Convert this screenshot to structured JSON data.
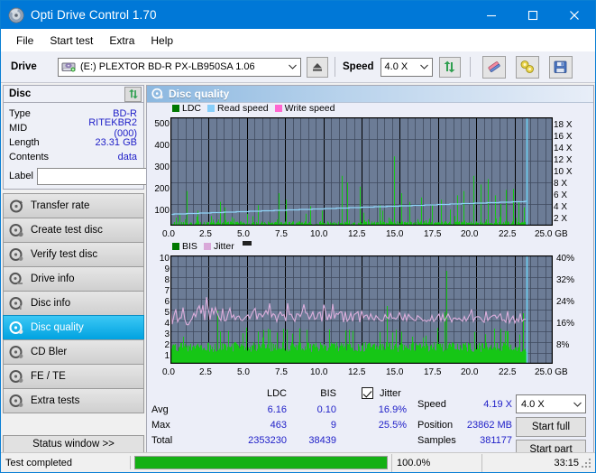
{
  "window": {
    "title": "Opti Drive Control 1.70",
    "icon": "disc-icon",
    "minimize": "−",
    "maximize": "□",
    "close": "✕",
    "titlebar_color": "#0078d7"
  },
  "menu": {
    "items": [
      "File",
      "Start test",
      "Extra",
      "Help"
    ]
  },
  "toolbar": {
    "drive_label": "Drive",
    "drive_value": "(E:)   PLEXTOR BD-R  PX-LB950SA 1.06",
    "eject_icon": "eject-icon",
    "speed_label": "Speed",
    "speed_value": "4.0 X",
    "refresh_icon": "refresh-icon",
    "erase_icon": "eraser-icon",
    "settings_icon": "wrench-icon",
    "save_icon": "floppy-save-icon"
  },
  "disc": {
    "header": "Disc",
    "refresh_icon": "refresh-icon",
    "rows": [
      {
        "key": "Type",
        "value": "BD-R"
      },
      {
        "key": "MID",
        "value": "RITEKBR2 (000)"
      },
      {
        "key": "Length",
        "value": "23.31 GB"
      },
      {
        "key": "Contents",
        "value": "data"
      }
    ],
    "label_key": "Label",
    "label_value": "",
    "label_placeholder": "",
    "label_button_icon": "disc-icon"
  },
  "nav": {
    "items": [
      {
        "label": "Transfer rate",
        "icon": "disc-transfer-icon",
        "selected": false
      },
      {
        "label": "Create test disc",
        "icon": "disc-create-icon",
        "selected": false
      },
      {
        "label": "Verify test disc",
        "icon": "disc-verify-icon",
        "selected": false
      },
      {
        "label": "Drive info",
        "icon": "disc-drive-icon",
        "selected": false
      },
      {
        "label": "Disc info",
        "icon": "disc-info-icon",
        "selected": false
      },
      {
        "label": "Disc quality",
        "icon": "disc-quality-icon",
        "selected": true
      },
      {
        "label": "CD Bler",
        "icon": "disc-bler-icon",
        "selected": false
      },
      {
        "label": "FE / TE",
        "icon": "disc-fete-icon",
        "selected": false
      },
      {
        "label": "Extra tests",
        "icon": "disc-extra-icon",
        "selected": false
      }
    ],
    "status_window": "Status window >>"
  },
  "main": {
    "header": "Disc quality",
    "header_icon": "disc-quality-icon"
  },
  "chart_data": [
    {
      "type": "line",
      "name": "top-chart",
      "title": "",
      "xlabel": "GB",
      "ylabel": "",
      "legend": [
        {
          "label": "LDC",
          "color": "#00a000"
        },
        {
          "label": "Read speed",
          "color": "#87cefa"
        },
        {
          "label": "Write speed",
          "color": "#ff66d0"
        }
      ],
      "legend_position": "top-left",
      "grid": true,
      "plot_bg": "#6c7c96",
      "x": [
        0.0,
        2.5,
        5.0,
        7.5,
        10.0,
        12.5,
        15.0,
        17.5,
        20.0,
        22.5,
        25.0
      ],
      "xtick_labels": [
        "0.0",
        "2.5",
        "5.0",
        "7.5",
        "10.0",
        "12.5",
        "15.0",
        "17.5",
        "20.0",
        "22.5",
        "25.0 GB"
      ],
      "xlim": [
        0,
        25
      ],
      "ylim": [
        0,
        500
      ],
      "ytick_labels": [
        "100",
        "200",
        "300",
        "400",
        "500"
      ],
      "yticks": [
        100,
        200,
        300,
        400,
        500
      ],
      "y2lim": [
        0,
        19
      ],
      "y2tick_labels": [
        "2 X",
        "4 X",
        "6 X",
        "8 X",
        "10 X",
        "12 X",
        "14 X",
        "16 X",
        "18 X"
      ],
      "y2ticks": [
        2,
        4,
        6,
        8,
        10,
        12,
        14,
        16,
        18
      ],
      "data_end_gb": 23.31,
      "series": [
        {
          "name": "LDC",
          "color": "#00c000",
          "style": "bars",
          "note": "mostly under 50, dense spikes; max 463 near 17.0 GB"
        },
        {
          "name": "Read speed",
          "color": "#87cefa",
          "style": "step-line",
          "note": "rises 2.0X to 4.2X across disc"
        }
      ]
    },
    {
      "type": "line",
      "name": "bottom-chart",
      "title": "",
      "xlabel": "GB",
      "ylabel": "",
      "legend": [
        {
          "label": "BIS",
          "color": "#00a000"
        },
        {
          "label": "Jitter",
          "color": "#d9a8d9"
        }
      ],
      "legend_position": "top-left",
      "grid": true,
      "plot_bg": "#6c7c96",
      "x": [
        0.0,
        2.5,
        5.0,
        7.5,
        10.0,
        12.5,
        15.0,
        17.5,
        20.0,
        22.5,
        25.0
      ],
      "xtick_labels": [
        "0.0",
        "2.5",
        "5.0",
        "7.5",
        "10.0",
        "12.5",
        "15.0",
        "17.5",
        "20.0",
        "22.5",
        "25.0 GB"
      ],
      "xlim": [
        0,
        25
      ],
      "ylim": [
        0,
        10
      ],
      "ytick_labels": [
        "1",
        "2",
        "3",
        "4",
        "5",
        "6",
        "7",
        "8",
        "9",
        "10"
      ],
      "yticks": [
        1,
        2,
        3,
        4,
        5,
        6,
        7,
        8,
        9,
        10
      ],
      "y2lim": [
        0,
        40
      ],
      "y2tick_labels": [
        "8%",
        "16%",
        "24%",
        "32%",
        "40%"
      ],
      "y2ticks": [
        8,
        16,
        24,
        32,
        40
      ],
      "data_end_gb": 23.31,
      "series": [
        {
          "name": "BIS",
          "color": "#00c000",
          "style": "bars",
          "note": "dense band near 1-2, spikes to 9"
        },
        {
          "name": "Jitter",
          "color": "#d9a8d9",
          "style": "line",
          "note": "oscillates 16-24%, avg 16.9%, max 25.5%"
        }
      ]
    }
  ],
  "stats": {
    "col_headers": [
      "LDC",
      "BIS"
    ],
    "jitter_label": "Jitter",
    "jitter_checked": true,
    "rows": [
      {
        "label": "Avg",
        "ldc": "6.16",
        "bis": "0.10",
        "jitter": "16.9%"
      },
      {
        "label": "Max",
        "ldc": "463",
        "bis": "9",
        "jitter": "25.5%"
      },
      {
        "label": "Total",
        "ldc": "2353230",
        "bis": "38439",
        "jitter": ""
      }
    ],
    "speed_label": "Speed",
    "speed_value": "4.19 X",
    "speed_select": "4.0 X",
    "position_label": "Position",
    "position_value": "23862 MB",
    "samples_label": "Samples",
    "samples_value": "381177",
    "start_full": "Start full",
    "start_part": "Start part"
  },
  "statusbar": {
    "message": "Test completed",
    "progress_percent": 100.0,
    "progress_text": "100.0%",
    "elapsed": "33:15"
  }
}
